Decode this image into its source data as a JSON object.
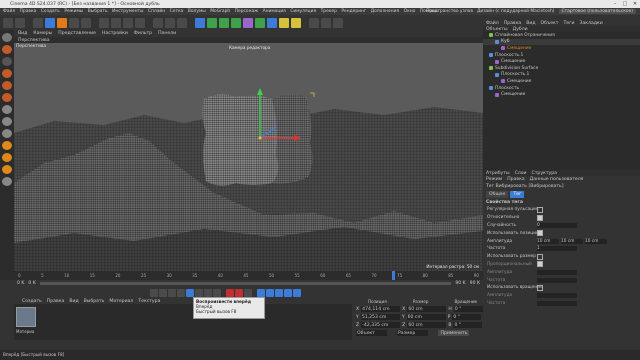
{
  "title_bar": {
    "title": "Cinema 4D S24.037 (RC) - [Без названия 1 *] - Основной дубль",
    "controls": [
      "–",
      "□",
      "✕"
    ]
  },
  "menu": {
    "items": [
      "Файл",
      "Правка",
      "Создать",
      "Режимы",
      "Выбрать",
      "Инструменты",
      "Сплайн",
      "Сетка",
      "Волумы",
      "MoGraph",
      "Персонаж",
      "Анимация",
      "Симуляция",
      "Трекер",
      "Рендеринг",
      "Дополнения",
      "Окно",
      "Помощь"
    ],
    "layout_label": "Пространство узлов",
    "layout_value": "Стартовое (пользовательское)",
    "layout_option": "Дизайн (с подударной Macintosh)"
  },
  "toolbar": {
    "accent_blue": "#3d7bd9",
    "accent_green": "#3fa24a",
    "accent_orange": "#e07a1a"
  },
  "viewport": {
    "menu": [
      "Вид",
      "Камеры",
      "Представление",
      "Настройки",
      "Фильтр",
      "Панели"
    ],
    "name": "Перспектива",
    "camera_label": "Камера редактора",
    "grid_label": "Интервал растра: 50 см"
  },
  "timeline": {
    "ticks": [
      "0",
      "5",
      "10",
      "15",
      "20",
      "25",
      "30",
      "35",
      "40",
      "45",
      "50",
      "55",
      "60",
      "65",
      "70",
      "75",
      "80",
      "85",
      "90"
    ],
    "start": "0 K",
    "start2": "0 K",
    "end": "90 K",
    "end2": "90 K"
  },
  "material_manager": {
    "menu": [
      "Создать",
      "Правка",
      "Вид",
      "Выбрать",
      "Материал",
      "Текстура"
    ],
    "material_name": "Материа"
  },
  "tooltip": {
    "title": "Воспроизвести вперёд",
    "line1": "Вперёд",
    "line2": "Быстрый вызов F8"
  },
  "coordinates": {
    "headers": [
      "Позиция",
      "Размер",
      "Вращение"
    ],
    "rows": [
      {
        "axis": "X",
        "pos": "474,114 cm",
        "size_axis": "X",
        "size": "60 cm",
        "rot_axis": "H",
        "rot": "0 °"
      },
      {
        "axis": "Y",
        "pos": "51,253 cm",
        "size_axis": "Y",
        "size": "60 cm",
        "rot_axis": "P",
        "rot": "0 °"
      },
      {
        "axis": "Z",
        "pos": "-42,335 cm",
        "size_axis": "Z",
        "size": "60 cm",
        "rot_axis": "B",
        "rot": "0 °"
      }
    ],
    "mode": "Объект",
    "size_mode": "Размер",
    "apply_button": "Применить"
  },
  "object_manager": {
    "tabs": [
      "Файл",
      "Правка",
      "Вид",
      "Объект",
      "Теги",
      "Закладки"
    ],
    "subtabs": [
      "Объекты",
      "Дубли"
    ],
    "objects": [
      {
        "name": "Сплайновая Ограничения",
        "indent": 1,
        "color": "#7cc34a"
      },
      {
        "name": "Куб",
        "indent": 2,
        "color": "#5a8fd8"
      },
      {
        "name": "Смещение",
        "indent": 3,
        "color": "#9a66cc"
      },
      {
        "name": "Плоскость.1",
        "indent": 1,
        "color": "#5a8fd8"
      },
      {
        "name": "Смещение",
        "indent": 2,
        "color": "#9a66cc"
      },
      {
        "name": "Subdivision Surface",
        "indent": 1,
        "color": "#7cc34a"
      },
      {
        "name": "Плоскость.1",
        "indent": 2,
        "color": "#5a8fd8"
      },
      {
        "name": "Смещение",
        "indent": 3,
        "color": "#9a66cc"
      },
      {
        "name": "Плоскость",
        "indent": 1,
        "color": "#5a8fd8"
      },
      {
        "name": "Смещение",
        "indent": 2,
        "color": "#9a66cc"
      }
    ]
  },
  "attributes": {
    "tabs": [
      "Атрибуты",
      "Слои",
      "Структура"
    ],
    "menu": [
      "Режим",
      "Правка",
      "Данные пользователя"
    ],
    "tag_title": "Тег Вибрировать [Вибрировать]",
    "subtabs": [
      "Общее",
      "Тег"
    ],
    "section": "Свойства тега",
    "props": [
      {
        "label": "Регулярная пульсация",
        "type": "check",
        "checked": false
      },
      {
        "label": "Относительно",
        "type": "check",
        "checked": true
      },
      {
        "label": "Случайность",
        "type": "field",
        "value": "0"
      },
      {
        "label": "Использовать позицию",
        "type": "check",
        "checked": true
      },
      {
        "label": "Амплитуда",
        "type": "triple",
        "values": [
          "10 cm",
          "10 cm",
          "10 cm"
        ]
      },
      {
        "label": "Частота",
        "type": "field",
        "value": "1"
      },
      {
        "label": "Использовать размер",
        "type": "check",
        "checked": false
      },
      {
        "label": "Пропорциональный",
        "type": "check",
        "checked": true
      },
      {
        "label": "Амплитуда",
        "type": "field",
        "value": ""
      },
      {
        "label": "Частота",
        "type": "field",
        "value": ""
      },
      {
        "label": "Использовать вращение",
        "type": "check",
        "checked": false
      },
      {
        "label": "Амплитуда",
        "type": "field",
        "value": ""
      },
      {
        "label": "Частота",
        "type": "field",
        "value": ""
      }
    ]
  },
  "status": {
    "text": "Вперёд [Быстрый вызов F8]"
  }
}
